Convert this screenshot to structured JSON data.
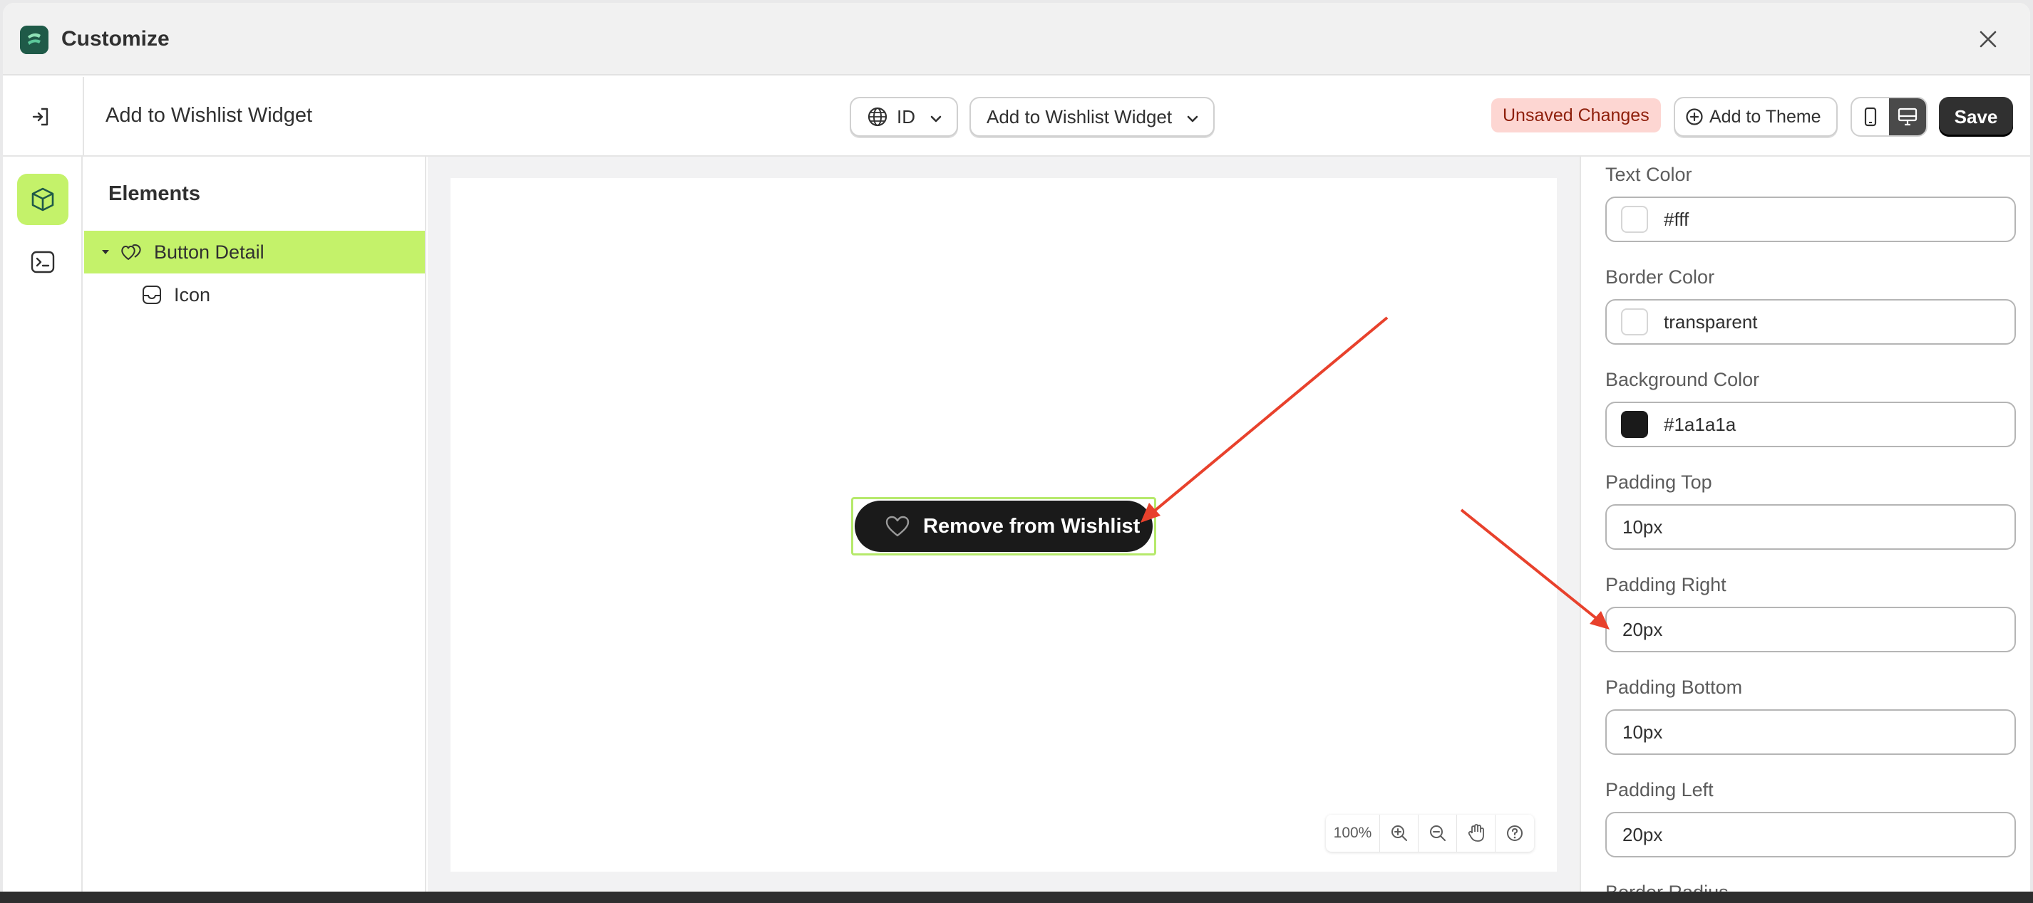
{
  "window": {
    "title": "Customize"
  },
  "toolbar": {
    "page_title": "Add to Wishlist Widget",
    "language_label": "ID",
    "widget_select_label": "Add to Wishlist Widget",
    "unsaved_badge": "Unsaved Changes",
    "add_to_theme_label": "Add to Theme",
    "save_label": "Save",
    "active_view": "desktop"
  },
  "elements_panel": {
    "title": "Elements",
    "tree": [
      {
        "label": "Button Detail",
        "selected": true,
        "expanded": true
      },
      {
        "label": "Icon",
        "selected": false
      }
    ]
  },
  "preview": {
    "button_label": "Remove from Wishlist",
    "zoom_level": "100%"
  },
  "settings": {
    "fields": [
      {
        "label": "Text Color",
        "value": "#fff",
        "swatch": "#ffffff"
      },
      {
        "label": "Border Color",
        "value": "transparent",
        "swatch": "#ffffff"
      },
      {
        "label": "Background Color",
        "value": "#1a1a1a",
        "swatch": "#1a1a1a"
      },
      {
        "label": "Padding Top",
        "value": "10px"
      },
      {
        "label": "Padding Right",
        "value": "20px"
      },
      {
        "label": "Padding Bottom",
        "value": "10px"
      },
      {
        "label": "Padding Left",
        "value": "20px"
      },
      {
        "label": "Border Radius"
      }
    ]
  },
  "colors": {
    "accent": "#c4f26a",
    "annotation_arrow": "#e8412c",
    "dark": "#1a1a1a"
  },
  "icons": [
    "app-logo",
    "close-icon",
    "exit-icon",
    "globe-icon",
    "chevron-down-icon",
    "plus-circle-icon",
    "mobile-icon",
    "desktop-icon",
    "cube-icon",
    "terminal-icon",
    "heart-icon",
    "zoom-in-icon",
    "zoom-out-icon",
    "hand-icon",
    "help-icon"
  ]
}
